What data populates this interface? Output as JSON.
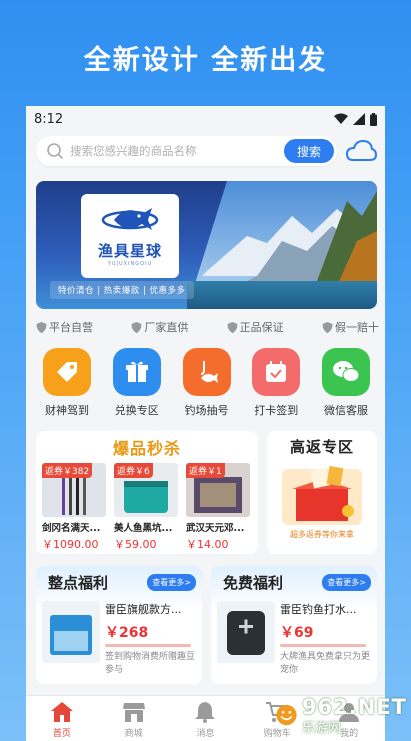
{
  "promo": {
    "headline": "全新设计  全新出发"
  },
  "status_bar": {
    "time": "8:12"
  },
  "search": {
    "placeholder": "搜索您感兴趣的商品名称",
    "button_label": "搜索"
  },
  "banner": {
    "logo_text": "渔具星球",
    "logo_subtext": "YUJUXINGQIU",
    "slogan": "特价清仓 | 热卖爆款 | 优惠多多"
  },
  "trust_badges": [
    "平台自营",
    "厂家直供",
    "正品保证",
    "假一赔十"
  ],
  "quick_actions": [
    {
      "label": "财神驾到",
      "icon": "tag-icon",
      "color": "#f7a11a"
    },
    {
      "label": "兑换专区",
      "icon": "gift-icon",
      "color": "#2d8ef0"
    },
    {
      "label": "钓场抽号",
      "icon": "fishing-icon",
      "color": "#f46d2c"
    },
    {
      "label": "打卡签到",
      "icon": "calendar-check-icon",
      "color": "#f36b6b"
    },
    {
      "label": "微信客服",
      "icon": "wechat-icon",
      "color": "#3cc451"
    }
  ],
  "flash_sale": {
    "title": "爆品秒杀",
    "items": [
      {
        "coupon": "返券￥382",
        "name": "剑冈名满天...",
        "price": "￥1090.00"
      },
      {
        "coupon": "返券￥6",
        "name": "美人鱼黑坑...",
        "price": "￥59.00"
      },
      {
        "coupon": "返券￥1",
        "name": "武汉天元邓...",
        "price": "￥14.00"
      }
    ]
  },
  "rebate": {
    "title": "高返专区",
    "note": "超多返券等你来拿"
  },
  "welfare": [
    {
      "title": "整点福利",
      "more": "查看更多>",
      "product_name": "雷臣旗舰款方...",
      "price": "￥268",
      "desc": "签到购物消费所赠趣豆参与"
    },
    {
      "title": "免费福利",
      "more": "查看更多>",
      "product_name": "雷臣钓鱼打水...",
      "price": "￥69",
      "desc": "大牌渔具免费拿只为更宠你"
    }
  ],
  "tabbar": [
    {
      "label": "首页",
      "icon": "home-icon",
      "active": true
    },
    {
      "label": "商城",
      "icon": "store-icon",
      "active": false
    },
    {
      "label": "消息",
      "icon": "bell-icon",
      "active": false
    },
    {
      "label": "购物车",
      "icon": "cart-icon",
      "active": false
    },
    {
      "label": "我的",
      "icon": "user-icon",
      "active": false
    }
  ],
  "watermark": {
    "main": "962.NET",
    "sub": "乐游网"
  }
}
